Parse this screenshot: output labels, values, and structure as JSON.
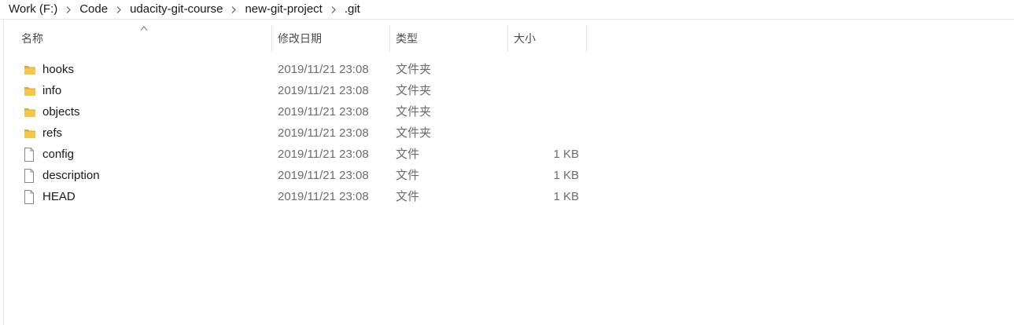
{
  "breadcrumb": {
    "items": [
      "Work (F:)",
      "Code",
      "udacity-git-course",
      "new-git-project",
      ".git"
    ],
    "separator_icon": "chevron-right-icon"
  },
  "columns": {
    "name": "名称",
    "date": "修改日期",
    "type": "类型",
    "size": "大小",
    "sort_indicator_icon": "sort-ascending-icon"
  },
  "files": [
    {
      "icon": "folder-icon",
      "name": "hooks",
      "date": "2019/11/21 23:08",
      "type": "文件夹",
      "size": ""
    },
    {
      "icon": "folder-icon",
      "name": "info",
      "date": "2019/11/21 23:08",
      "type": "文件夹",
      "size": ""
    },
    {
      "icon": "folder-icon",
      "name": "objects",
      "date": "2019/11/21 23:08",
      "type": "文件夹",
      "size": ""
    },
    {
      "icon": "folder-icon",
      "name": "refs",
      "date": "2019/11/21 23:08",
      "type": "文件夹",
      "size": ""
    },
    {
      "icon": "file-icon",
      "name": "config",
      "date": "2019/11/21 23:08",
      "type": "文件",
      "size": "1 KB"
    },
    {
      "icon": "file-icon",
      "name": "description",
      "date": "2019/11/21 23:08",
      "type": "文件",
      "size": "1 KB"
    },
    {
      "icon": "file-icon",
      "name": "HEAD",
      "date": "2019/11/21 23:08",
      "type": "文件",
      "size": "1 KB"
    }
  ],
  "colors": {
    "folder": "#f3c64c",
    "folder_dark": "#e0a82e",
    "file_outline": "#8a8a8a",
    "separator": "#e5e5e5"
  }
}
